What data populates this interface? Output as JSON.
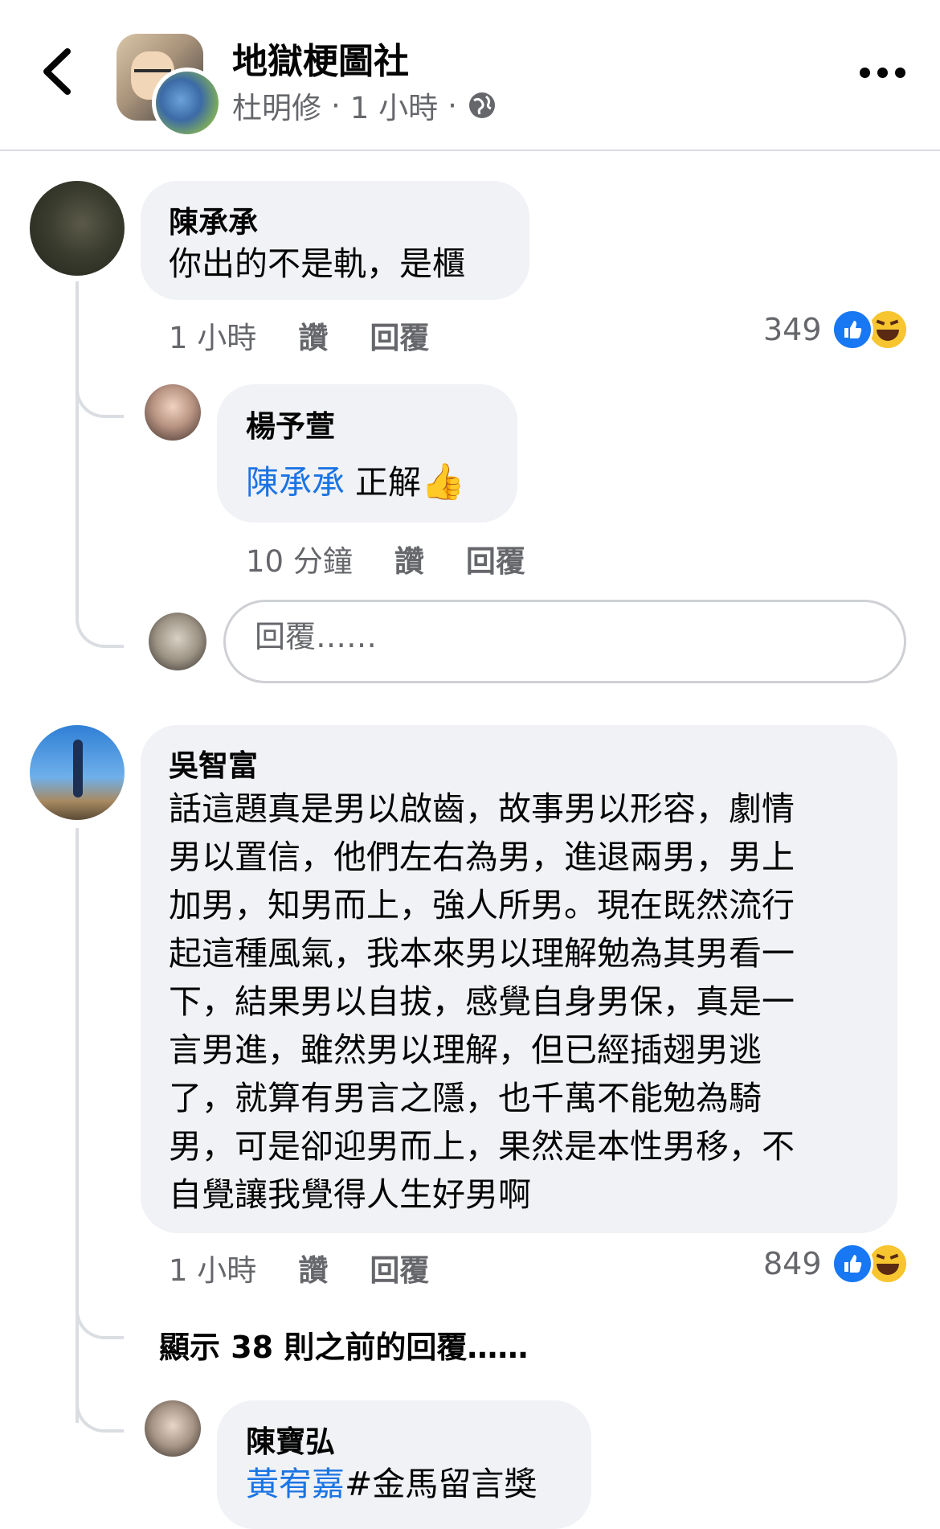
{
  "header": {
    "group_name": "地獄梗圖社",
    "author": "杜明修",
    "separator": "·",
    "time": "1 小時",
    "privacy_icon": "globe-icon",
    "back_icon": "chevron-left-icon",
    "more_icon": "more-horizontal-icon"
  },
  "comments": [
    {
      "name": "陳承承",
      "text": "你出的不是軌，是櫃",
      "time": "1 小時",
      "like_label": "讚",
      "reply_label": "回覆",
      "reaction_count": "349",
      "replies": [
        {
          "name": "楊予萱",
          "mention": "陳承承",
          "text": " 正解",
          "emoji": "👍",
          "time": "10 分鐘",
          "like_label": "讚",
          "reply_label": "回覆"
        }
      ]
    },
    {
      "name": "吳智富",
      "lines": [
        "話這題真是男以啟齒，故事男以形容，劇情",
        "男以置信，他們左右為男，進退兩男，男上",
        "加男，知男而上，強人所男。現在既然流行",
        "起這種風氣，我本來男以理解勉為其男看一",
        "下，結果男以自拔，感覺自身男保，真是一",
        "言男進，雖然男以理解，但已經插翅男逃",
        "了，就算有男言之隱，也千萬不能勉為騎",
        "男，可是卻迎男而上，果然是本性男移，不",
        "自覺讓我覺得人生好男啊"
      ],
      "time": "1 小時",
      "like_label": "讚",
      "reply_label": "回覆",
      "reaction_count": "849",
      "show_previous": "顯示 38 則之前的回覆……",
      "replies": [
        {
          "name": "陳寶弘",
          "mention": "黃宥嘉",
          "text": "#金馬留言獎"
        }
      ]
    }
  ],
  "reply_box": {
    "placeholder": "回覆……"
  },
  "colors": {
    "link": "#1b74e4",
    "bubble": "#f0f2f5",
    "muted": "#65676b",
    "like": "#1877f2",
    "haha": "#f7c52f"
  }
}
